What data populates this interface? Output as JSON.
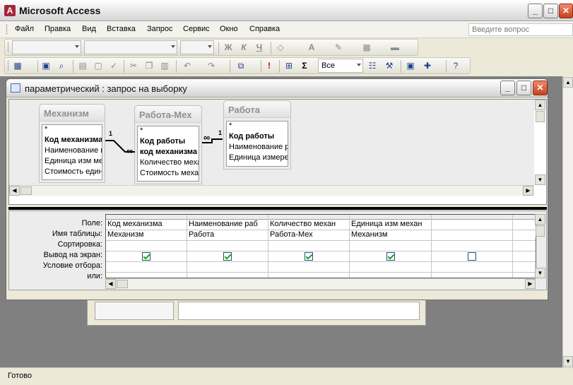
{
  "app": {
    "title": "Microsoft Access",
    "logo_letter": "A"
  },
  "window_controls": {
    "minimize": "_",
    "restore": "□",
    "close": "✕"
  },
  "menubar": {
    "items": [
      {
        "label": "Файл"
      },
      {
        "label": "Правка"
      },
      {
        "label": "Вид"
      },
      {
        "label": "Вставка"
      },
      {
        "label": "Запрос"
      },
      {
        "label": "Сервис"
      },
      {
        "label": "Окно"
      },
      {
        "label": "Справка"
      }
    ],
    "help_placeholder": "Введите вопрос"
  },
  "format_toolbar": {
    "bold": "Ж",
    "italic": "К",
    "underline": "Ч"
  },
  "query_toolbar": {
    "top_values_value": "Все",
    "totals_symbol": "Σ",
    "run_symbol": "!"
  },
  "query_window": {
    "title": "параметрический : запрос на выборку"
  },
  "tables": [
    {
      "name": "Механизм",
      "fields": [
        {
          "label": "*",
          "key": false
        },
        {
          "label": "Код механизма",
          "key": true
        },
        {
          "label": "Наименование м",
          "key": false
        },
        {
          "label": "Единица изм мех",
          "key": false
        },
        {
          "label": "Стоимость един",
          "key": false
        }
      ]
    },
    {
      "name": "Работа-Мех",
      "fields": [
        {
          "label": "*",
          "key": false
        },
        {
          "label": "Код работы",
          "key": true
        },
        {
          "label": "код механизма",
          "key": true
        },
        {
          "label": "Количество меха",
          "key": false
        },
        {
          "label": "Стоимость механ",
          "key": false
        }
      ]
    },
    {
      "name": "Работа",
      "fields": [
        {
          "label": "*",
          "key": false
        },
        {
          "label": "Код работы",
          "key": true
        },
        {
          "label": "Наименование р",
          "key": false
        },
        {
          "label": "Единица измере",
          "key": false
        }
      ]
    }
  ],
  "relations": {
    "one": "1",
    "many": "∞"
  },
  "qbe": {
    "row_labels": [
      "Поле:",
      "Имя таблицы:",
      "Сортировка:",
      "Вывод на экран:",
      "Условие отбора:",
      "или:"
    ],
    "columns": [
      {
        "field": "Код механизма",
        "table": "Механизм",
        "show": true
      },
      {
        "field": "Наименование раб",
        "table": "Работа",
        "show": true
      },
      {
        "field": "Количество механ",
        "table": "Работа-Мех",
        "show": true
      },
      {
        "field": "Единица изм механ",
        "table": "Механизм",
        "show": true
      },
      {
        "field": "",
        "table": "",
        "show": false
      },
      {
        "field": "",
        "table": "",
        "show": null
      }
    ]
  },
  "status": {
    "text": "Готово"
  }
}
